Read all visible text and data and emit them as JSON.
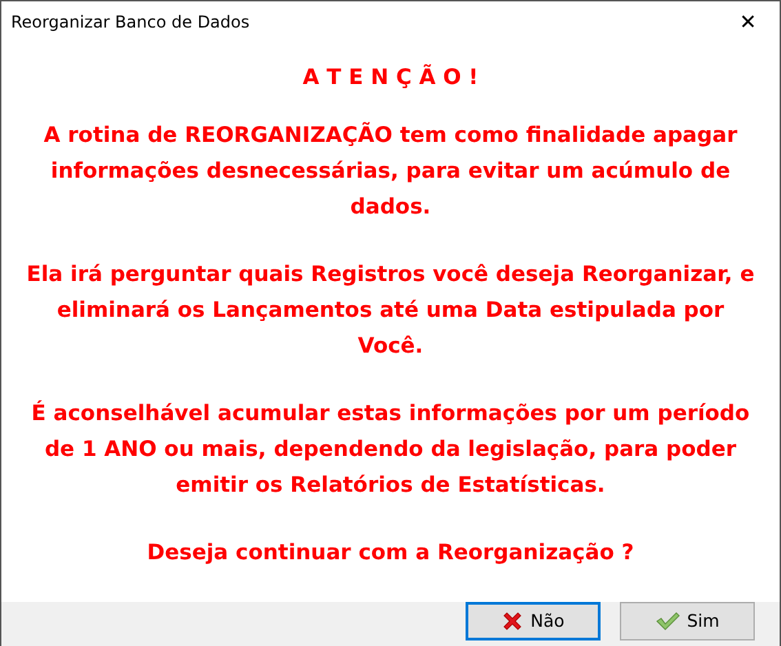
{
  "window": {
    "title": "Reorganizar Banco de Dados",
    "close": "✕"
  },
  "heading": "A T E N Ç Ã O !",
  "paragraphs": [
    "A rotina de REORGANIZAÇÃO tem como finalidade apagar informações desnecessárias, para evitar um acúmulo de dados.",
    "Ela irá perguntar quais Registros você deseja Reorganizar, e eliminará os Lançamentos até uma Data estipulada por Você.",
    "É aconselhável acumular estas informações por um período de 1 ANO ou mais, dependendo da legislação, para poder emitir os Relatórios de Estatísticas.",
    "Deseja continuar com a Reorganização ?"
  ],
  "buttons": [
    {
      "label": "Não",
      "kind": "no",
      "focused": true
    },
    {
      "label": "Sim",
      "kind": "yes",
      "focused": false
    }
  ]
}
